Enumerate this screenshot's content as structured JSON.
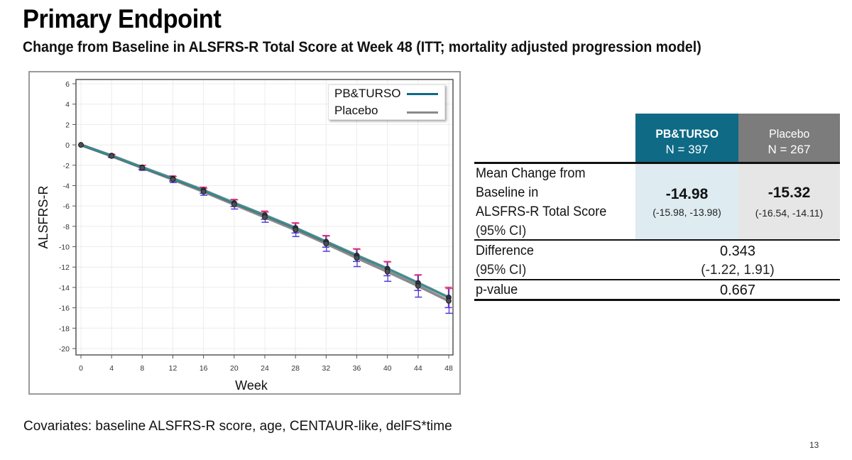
{
  "header": {
    "title": "Primary Endpoint",
    "subtitle": "Change from Baseline in ALSFRS-R Total Score at Week 48 (ITT; mortality adjusted progression model)"
  },
  "colors": {
    "pb_turso": "#0e6a85",
    "pb_turso_line": "#2e8f98",
    "placebo": "#7c7c7c",
    "placebo_line": "#8a8a8a",
    "pb_turso_cell": "#deebf1",
    "placebo_cell": "#e6e6e6",
    "ci_upper": "#d9307a",
    "ci_lower": "#4a3adf"
  },
  "chart_data": {
    "type": "line",
    "title": "",
    "xlabel": "Week",
    "ylabel": "ALSFRS-R",
    "xlim": [
      0,
      48
    ],
    "ylim": [
      -20,
      6
    ],
    "x_ticks": [
      0,
      4,
      8,
      12,
      16,
      20,
      24,
      28,
      32,
      36,
      40,
      44,
      48
    ],
    "y_ticks": [
      6,
      4,
      2,
      0,
      -2,
      -4,
      -6,
      -8,
      -10,
      -12,
      -14,
      -16,
      -18,
      -20
    ],
    "grid": true,
    "legend_position": "top-right",
    "x": [
      0,
      4,
      8,
      12,
      16,
      20,
      24,
      28,
      32,
      36,
      40,
      44,
      48
    ],
    "series": [
      {
        "name": "PB&TURSO",
        "values": [
          0,
          -1.05,
          -2.2,
          -3.3,
          -4.45,
          -5.7,
          -6.9,
          -8.15,
          -9.5,
          -10.85,
          -12.15,
          -13.55,
          -14.98
        ],
        "ci_lower": [
          0,
          -1.2,
          -2.4,
          -3.55,
          -4.75,
          -6.05,
          -7.3,
          -8.65,
          -10.05,
          -11.45,
          -12.85,
          -14.3,
          -15.98
        ],
        "ci_upper": [
          0,
          -0.9,
          -2.0,
          -3.05,
          -4.15,
          -5.35,
          -6.5,
          -7.65,
          -8.9,
          -10.2,
          -11.45,
          -12.8,
          -13.98
        ]
      },
      {
        "name": "Placebo",
        "values": [
          0,
          -1.1,
          -2.25,
          -3.4,
          -4.6,
          -5.85,
          -7.1,
          -8.35,
          -9.7,
          -11.1,
          -12.45,
          -13.85,
          -15.32
        ],
        "ci_lower": [
          0,
          -1.25,
          -2.5,
          -3.7,
          -4.95,
          -6.3,
          -7.6,
          -9.0,
          -10.45,
          -11.95,
          -13.4,
          -14.95,
          -16.54
        ],
        "ci_upper": [
          0,
          -0.95,
          -2.0,
          -3.1,
          -4.25,
          -5.4,
          -6.6,
          -7.7,
          -8.95,
          -10.25,
          -11.5,
          -12.75,
          -14.11
        ]
      }
    ]
  },
  "table": {
    "columns": [
      {
        "name": "PB&TURSO",
        "n": "N = 397"
      },
      {
        "name": "Placebo",
        "n": "N = 267"
      }
    ],
    "rows": {
      "mean_change": {
        "label_lines": [
          "Mean Change from",
          "Baseline in",
          "ALSFRS-R Total Score"
        ],
        "ci_label": "(95% CI)",
        "pb_value": "-14.98",
        "pb_ci": "(-15.98, -13.98)",
        "placebo_value": "-15.32",
        "placebo_ci": "(-16.54, -14.11)"
      },
      "difference": {
        "label": "Difference",
        "ci_label": "(95% CI)",
        "value": "0.343",
        "ci": "(-1.22, 1.91)"
      },
      "p_value": {
        "label": "p-value",
        "value": "0.667"
      }
    }
  },
  "footnote": "Covariates: baseline ALSFRS-R score, age, CENTAUR-like, delFS*time",
  "page_number": "13"
}
